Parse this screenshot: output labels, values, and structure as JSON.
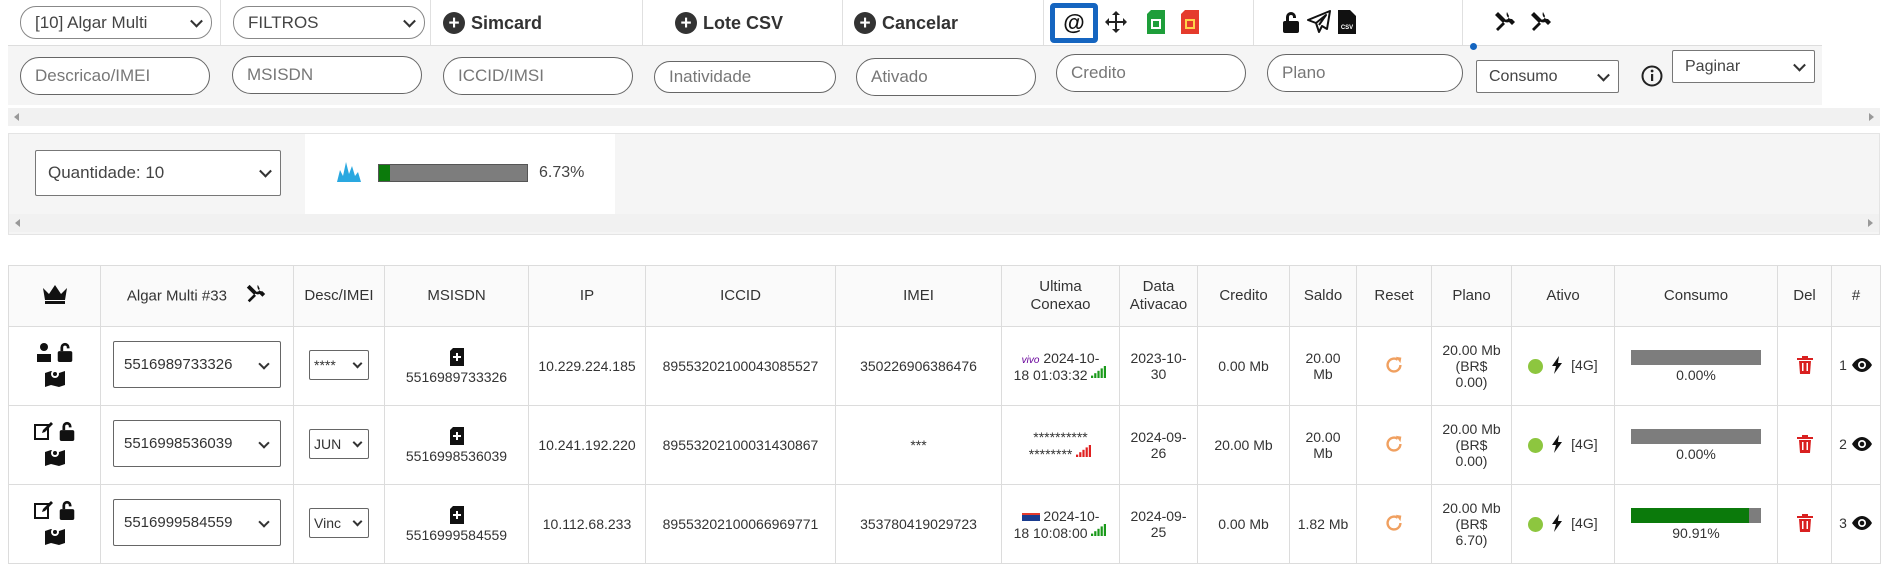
{
  "toolbar": {
    "client_select": "[10] Algar Multi",
    "filters_select": "FILTROS",
    "btn_simcard": "Simcard",
    "btn_lote_csv": "Lote CSV",
    "btn_cancelar": "Cancelar",
    "consumo_select": "Consumo",
    "paginar_select": "Paginar"
  },
  "filters": {
    "descricao": "Descricao/IMEI",
    "msisdn": "MSISDN",
    "iccid": "ICCID/IMSI",
    "inatividade": "Inatividade",
    "ativado": "Ativado",
    "credito": "Credito",
    "plano": "Plano"
  },
  "quantity": {
    "select": "Quantidade: 10",
    "usage_percent_label": "6.73%",
    "usage_fraction": 0.0673
  },
  "table": {
    "headers": {
      "algar": "Algar Multi #33",
      "desc": "Desc/IMEI",
      "msisdn": "MSISDN",
      "ip": "IP",
      "iccid": "ICCID",
      "imei": "IMEI",
      "ultima1": "Ultima",
      "ultima2": "Conexao",
      "data1": "Data",
      "data2": "Ativacao",
      "credito": "Credito",
      "saldo": "Saldo",
      "reset": "Reset",
      "plano": "Plano",
      "ativo": "Ativo",
      "consumo": "Consumo",
      "del": "Del",
      "hash": "#"
    },
    "rows": [
      {
        "select_value": "5516989733326",
        "desc_value": "****",
        "msisdn": "5516989733326",
        "ip": "10.229.224.185",
        "iccid": "89553202100043085527",
        "imei": "350226906386476",
        "operator": "vivo",
        "ultima_a": "2024-10-",
        "ultima_b": "18 01:03:32",
        "data_a": "2023-10-",
        "data_b": "30",
        "credito": "0.00 Mb",
        "saldo_a": "20.00",
        "saldo_b": "Mb",
        "plano_a": "20.00 Mb",
        "plano_b": "(BR$",
        "plano_c": "0.00)",
        "network": "[4G]",
        "consumo_label": "0.00%",
        "consumo_fraction": 0.0,
        "index": "1",
        "signal_color": "#1a9a1a"
      },
      {
        "select_value": "5516998536039",
        "desc_value": "JUN",
        "msisdn": "5516998536039",
        "ip": "10.241.192.220",
        "iccid": "89553202100031430867",
        "imei": "***",
        "operator": "",
        "ultima_a": "**********",
        "ultima_b": "********",
        "data_a": "2024-09-",
        "data_b": "26",
        "credito": "20.00 Mb",
        "saldo_a": "20.00",
        "saldo_b": "Mb",
        "plano_a": "20.00 Mb",
        "plano_b": "(BR$",
        "plano_c": "0.00)",
        "network": "[4G]",
        "consumo_label": "0.00%",
        "consumo_fraction": 0.0,
        "index": "2",
        "signal_color": "#e02020"
      },
      {
        "select_value": "5516999584559",
        "desc_value": "Vinc",
        "msisdn": "5516999584559",
        "ip": "10.112.68.233",
        "iccid": "89553202100066969771",
        "imei": "353780419029723",
        "operator": "claro",
        "ultima_a": "2024-10-",
        "ultima_b": "18 10:08:00",
        "data_a": "2024-09-",
        "data_b": "25",
        "credito": "0.00 Mb",
        "saldo_a": "1.82 Mb",
        "saldo_b": "",
        "plano_a": "20.00 Mb",
        "plano_b": "(BR$",
        "plano_c": "6.70)",
        "network": "[4G]",
        "consumo_label": "90.91%",
        "consumo_fraction": 0.9091,
        "index": "3",
        "signal_color": "#1a9a1a"
      }
    ]
  },
  "colors": {
    "accent_blue": "#1565c0",
    "progress_green": "#0b7a0b",
    "progress_gray": "#7d7d7d",
    "active_dot": "#8dc63f",
    "reset_orange": "#f0a060",
    "delete_red": "#d92020",
    "sim_green": "#1e9e3a",
    "sim_red": "#e53b2c",
    "chart_blue": "#2aa8e0"
  },
  "icons": {
    "toolbar": [
      "at-sign-icon",
      "move-icon",
      "green-sim-icon",
      "red-sim-icon",
      "unlock-icon",
      "send-icon",
      "csv-file-icon",
      "tools-icon",
      "tools-icon-2",
      "info-icon"
    ],
    "table": [
      "crown-icon",
      "tools-icon",
      "sim-card-icon",
      "refresh-icon",
      "bolt-icon",
      "trash-icon",
      "eye-icon",
      "map-pin-icon",
      "lock-open-icon",
      "edit-icon"
    ]
  }
}
